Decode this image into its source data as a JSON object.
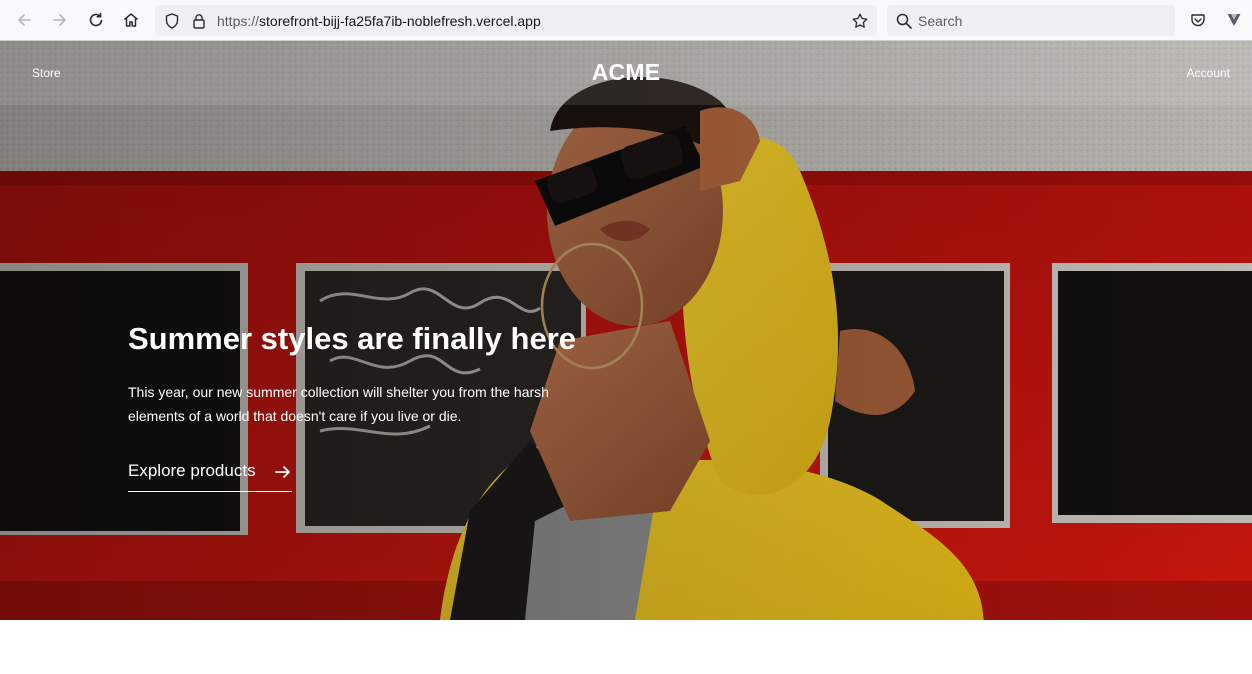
{
  "browser": {
    "url_protocol": "https://",
    "url_host": "storefront-bijj-fa25fa7ib-noblefresh.vercel.app",
    "search_placeholder": "Search",
    "icons": [
      "back-icon",
      "forward-icon",
      "reload-icon",
      "home-icon",
      "shield-icon",
      "lock-icon",
      "bookmark-star-icon",
      "search-icon",
      "pocket-icon",
      "extensions-icon"
    ]
  },
  "nav": {
    "store_label": "Store",
    "logo": "ACME",
    "account_label": "Account"
  },
  "hero": {
    "title": "Summer styles are finally here",
    "body": "This year, our new summer collection will shelter you from the harsh elements of a world that doesn't care if you live or die.",
    "cta_label": "Explore products",
    "cta_icon": "arrow-right-icon"
  },
  "colors": {
    "accent_red": "#c2120c",
    "jacket_yellow": "#f2cc1a",
    "text_on_hero": "#ffffff"
  }
}
